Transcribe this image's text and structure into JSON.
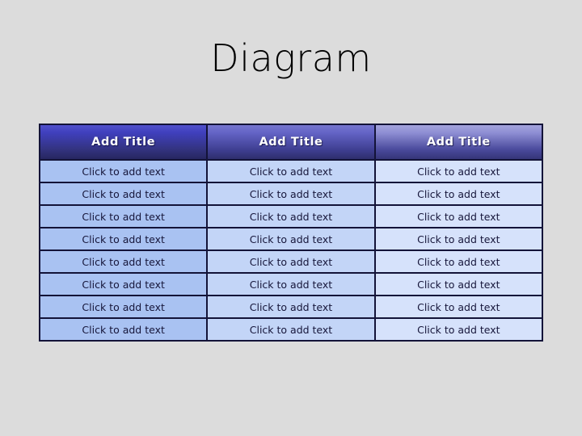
{
  "slide": {
    "title": "Diagram",
    "background_color": "#dcdcdc",
    "title_color": "#000000"
  },
  "table": {
    "border_color": "#131338",
    "columns": 3,
    "body_rows": 8,
    "header": {
      "cells": [
        {
          "label": "Add Title",
          "gradient_top": "#5050cc",
          "gradient_bottom": "#262660"
        },
        {
          "label": "Add Title",
          "gradient_top": "#7676cf",
          "gradient_bottom": "#2e2e6c"
        },
        {
          "label": "Add Title",
          "gradient_top": "#a3a3dc",
          "gradient_bottom": "#353578"
        }
      ],
      "text_color": "#ffffff"
    },
    "body": {
      "text_color": "#16163a",
      "column_colors": [
        "#a9c2f2",
        "#c3d5f7",
        "#d6e2fb"
      ],
      "rows": [
        [
          "Click to add text",
          "Click to add text",
          "Click to add text"
        ],
        [
          "Click to add text",
          "Click to add text",
          "Click to add text"
        ],
        [
          "Click to add text",
          "Click to add text",
          "Click to add text"
        ],
        [
          "Click to add text",
          "Click to add text",
          "Click to add text"
        ],
        [
          "Click to add text",
          "Click to add text",
          "Click to add text"
        ],
        [
          "Click to add text",
          "Click to add text",
          "Click to add text"
        ],
        [
          "Click to add text",
          "Click to add text",
          "Click to add text"
        ],
        [
          "Click to add text",
          "Click to add text",
          "Click to add text"
        ]
      ]
    }
  }
}
